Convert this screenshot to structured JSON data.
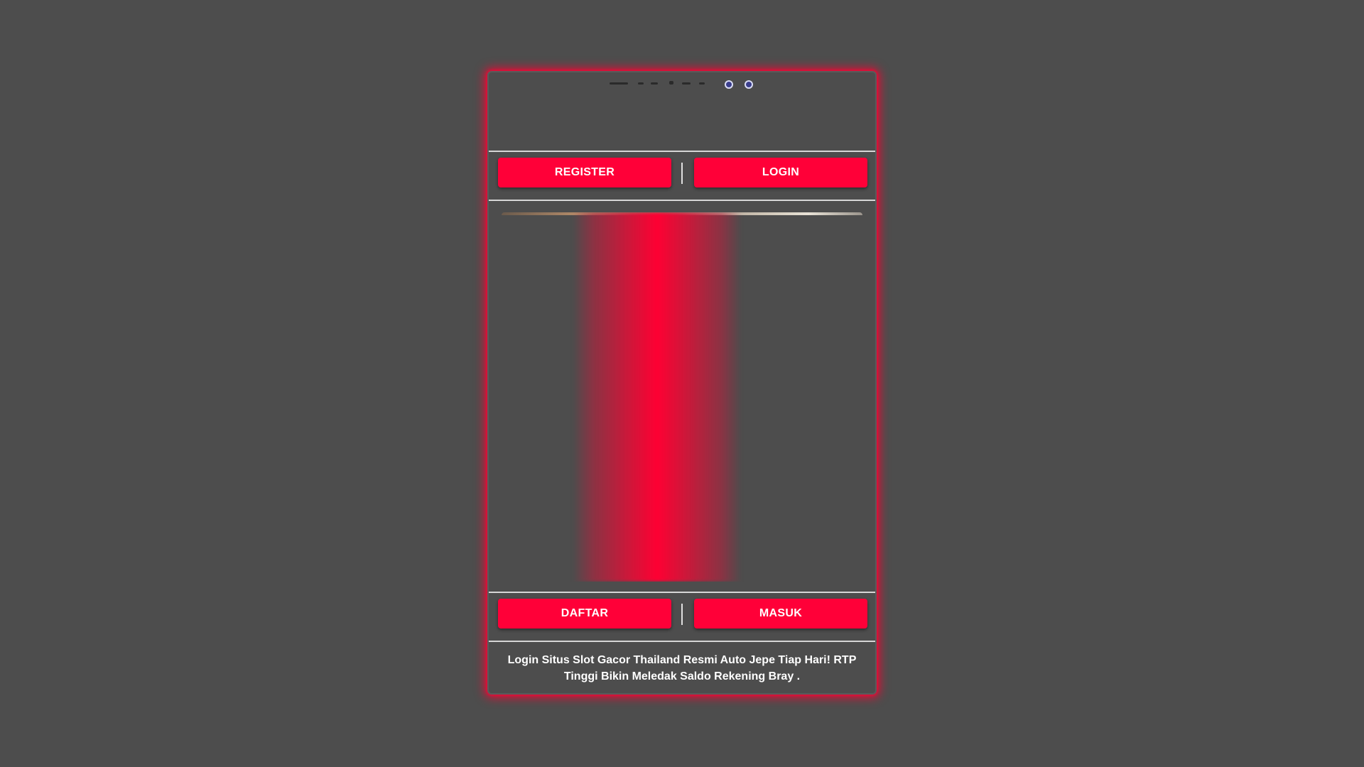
{
  "colors": {
    "background": "#4d4d4d",
    "accent": "#ff0038",
    "glow": "#ff0033",
    "divider": "#d6d6d6",
    "text": "#ffffff"
  },
  "top_buttons": {
    "register_label": "REGISTER",
    "login_label": "LOGIN"
  },
  "bottom_buttons": {
    "daftar_label": "DAFTAR",
    "masuk_label": "MASUK"
  },
  "footer": {
    "description": "Login Situs Slot Gacor Thailand Resmi Auto Jepe Tiap Hari! RTP Tinggi Bikin Meledak Saldo Rekening Bray ."
  }
}
